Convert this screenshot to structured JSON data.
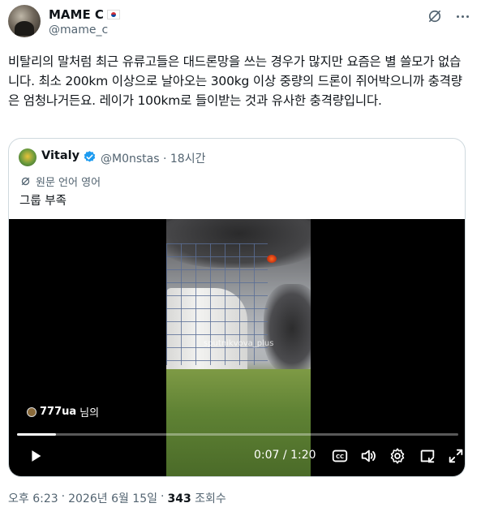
{
  "author": {
    "name": "MAME C",
    "flag_icon": "south-korea-flag-icon",
    "handle": "@mame_c"
  },
  "tweet": {
    "text": "비탈리의 말처럼 최근 유류고들은 대드론망을 쓰는 경우가 많지만 요즘은 별 쓸모가 없습니다. 최소 200km 이상으로 날아오는 300kg 이상 중량의 드론이 쥐어박으니까 충격량은 엄청나거든요. 레이가 100km로 들이받는 것과 유사한 충격량입니다."
  },
  "quote": {
    "name": "Vitaly",
    "handle": "@M0nstas",
    "separator": "·",
    "time_ago": "18시간",
    "translated_label": "원문 언어 영어",
    "text": "그룹 부족"
  },
  "video": {
    "watermark": "sputnikvova_plus",
    "credit_handle": "777ua",
    "credit_suffix": "님의",
    "current_time": "0:07",
    "total_time": "1:20",
    "progress": 0.088
  },
  "footer": {
    "time": "오후 6:23",
    "sep1": "·",
    "date": "2026년 6월 15일",
    "sep2": "·",
    "views": "343",
    "views_label": "조회수"
  },
  "colors": {
    "text_primary": "#0f1419",
    "text_secondary": "#536471",
    "verified_blue": "#1d9bf0",
    "border": "#cfd9de"
  }
}
